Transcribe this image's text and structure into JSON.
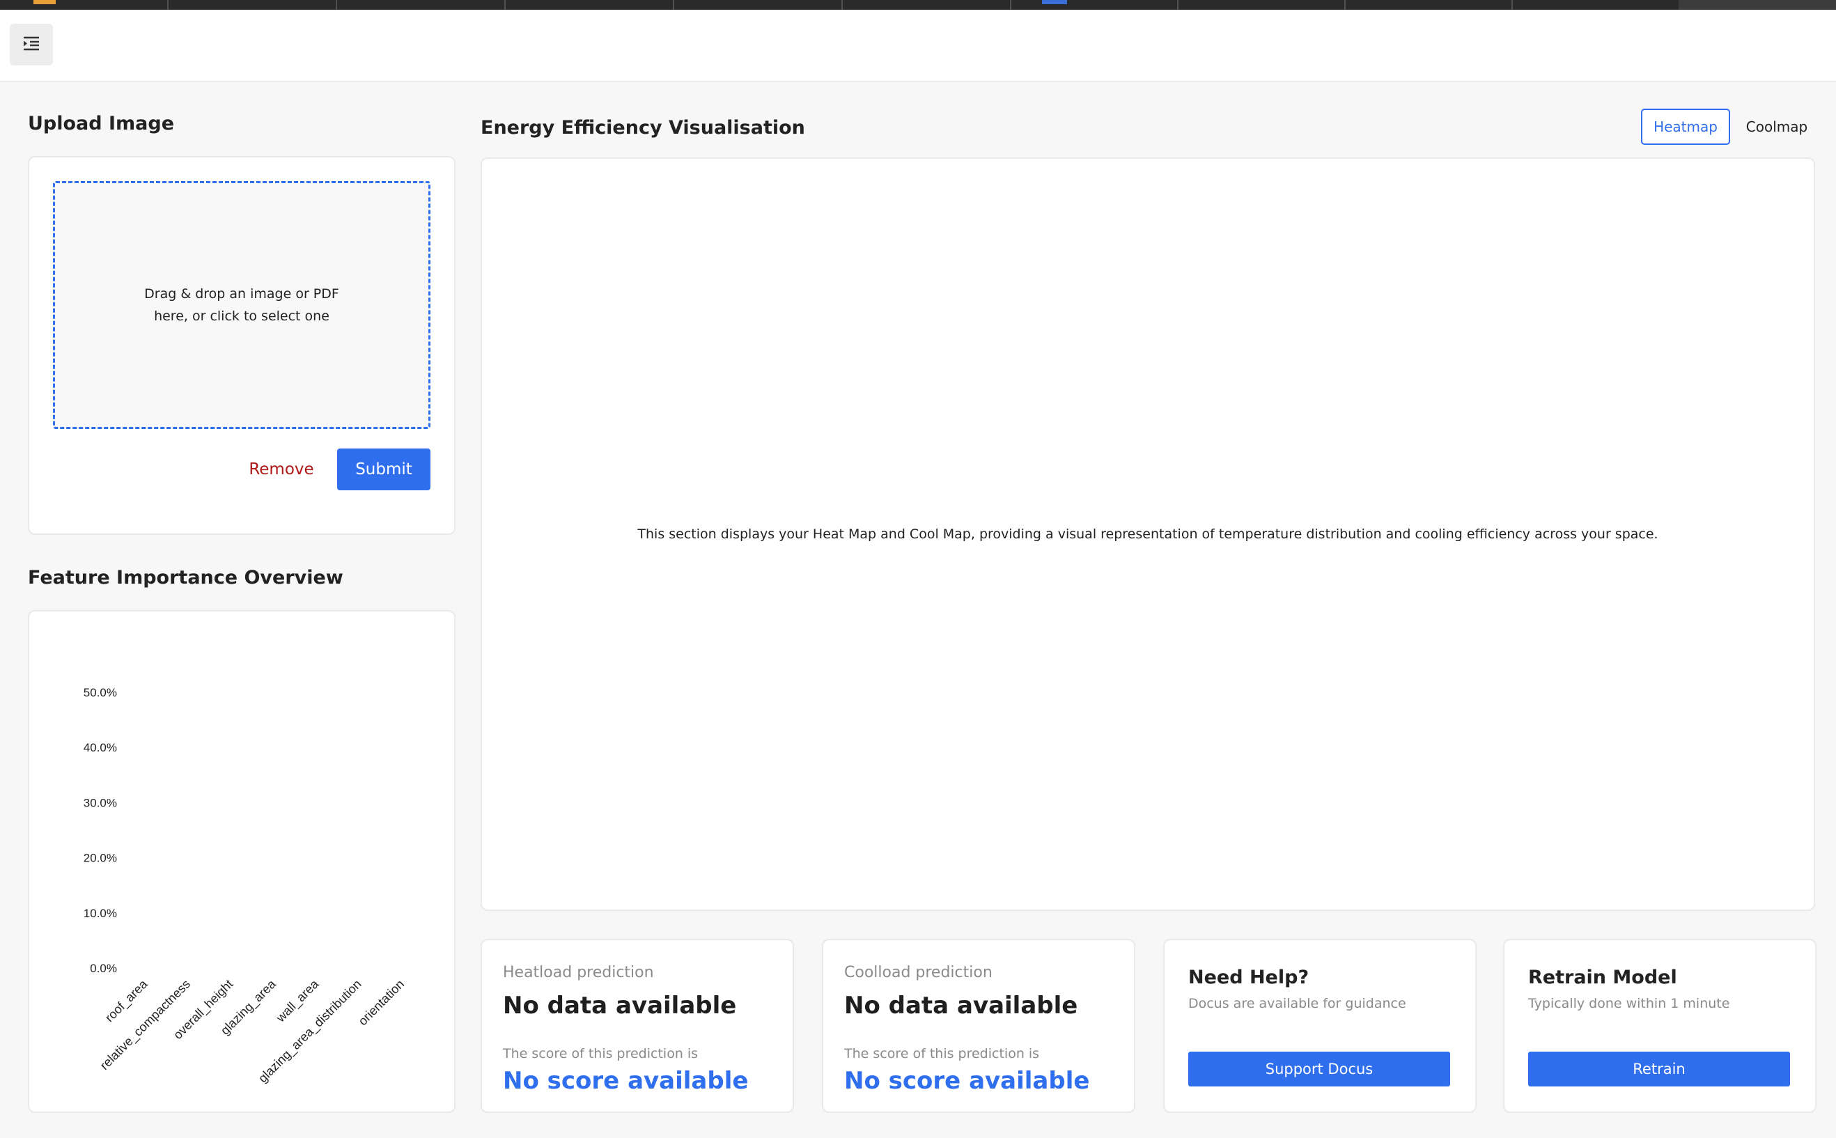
{
  "upload": {
    "title": "Upload Image",
    "dropzone_text": "Drag & drop an image or PDF here, or click to select one",
    "remove_label": "Remove",
    "submit_label": "Submit"
  },
  "features": {
    "title": "Feature Importance Overview"
  },
  "visualisation": {
    "title": "Energy Efficiency Visualisation",
    "toggle": [
      "Heatmap",
      "Coolmap"
    ],
    "selected": "Heatmap",
    "placeholder": "This section displays your Heat Map and Cool Map, providing a visual representation of temperature distribution and cooling efficiency across your space."
  },
  "cards": {
    "heatload": {
      "label": "Heatload prediction",
      "value": "No data available",
      "score_label": "The score of this prediction is",
      "score": "No score available"
    },
    "coolload": {
      "label": "Coolload prediction",
      "value": "No data available",
      "score_label": "The score of this prediction is",
      "score": "No score available"
    },
    "help": {
      "title": "Need Help?",
      "subtitle": "Docus are available for guidance",
      "button": "Support Docus"
    },
    "retrain": {
      "title": "Retrain Model",
      "subtitle": "Typically done within 1 minute",
      "button": "Retrain"
    }
  },
  "colors": {
    "accent": "#2f6fee",
    "danger": "#b01818",
    "muted": "#8a8a8a"
  },
  "icons": {
    "menu": "menu-indent-icon"
  },
  "chart_data": {
    "type": "bar",
    "title": "",
    "xlabel": "",
    "ylabel": "",
    "categories": [
      "roof_area",
      "relative_compactness",
      "overall_height",
      "glazing_area",
      "wall_area",
      "glazing_area_distribution",
      "orientation"
    ],
    "values": [
      0,
      0,
      0,
      0,
      0,
      0,
      0
    ],
    "yticks": [
      "0.0%",
      "10.0%",
      "20.0%",
      "30.0%",
      "40.0%",
      "50.0%"
    ],
    "ylim": [
      0,
      50
    ],
    "grid": false
  }
}
